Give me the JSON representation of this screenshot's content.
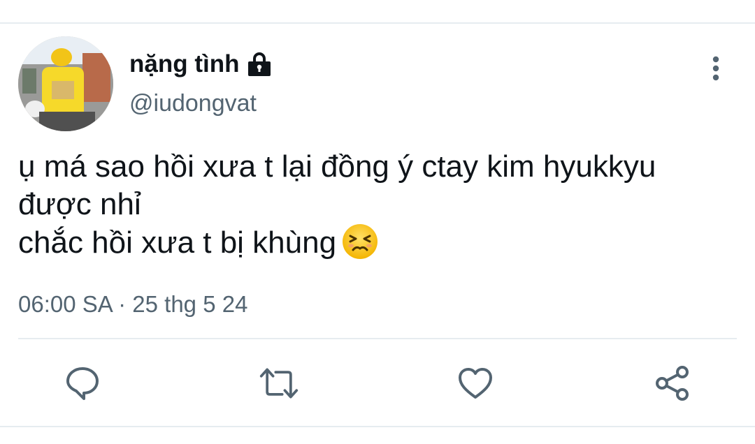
{
  "tweet": {
    "display_name": "nặng tình",
    "handle": "@iudongvat",
    "lines": [
      "ụ má sao hồi xưa t lại đồng ý ctay kim hyukkyu",
      "được nhỉ",
      "chắc hồi xưa t bị khùng"
    ],
    "emoji": "persevering-face-emoji",
    "timestamp": "06:00 SA · 25 thg 5 24"
  },
  "icons": {
    "lock": "lock-icon",
    "more": "more-vertical-icon",
    "actions": [
      "reply-icon",
      "retweet-icon",
      "like-icon",
      "share-icon"
    ]
  },
  "colors": {
    "text": "#0f1419",
    "secondary": "#536471",
    "divider": "#e6ecf0"
  }
}
